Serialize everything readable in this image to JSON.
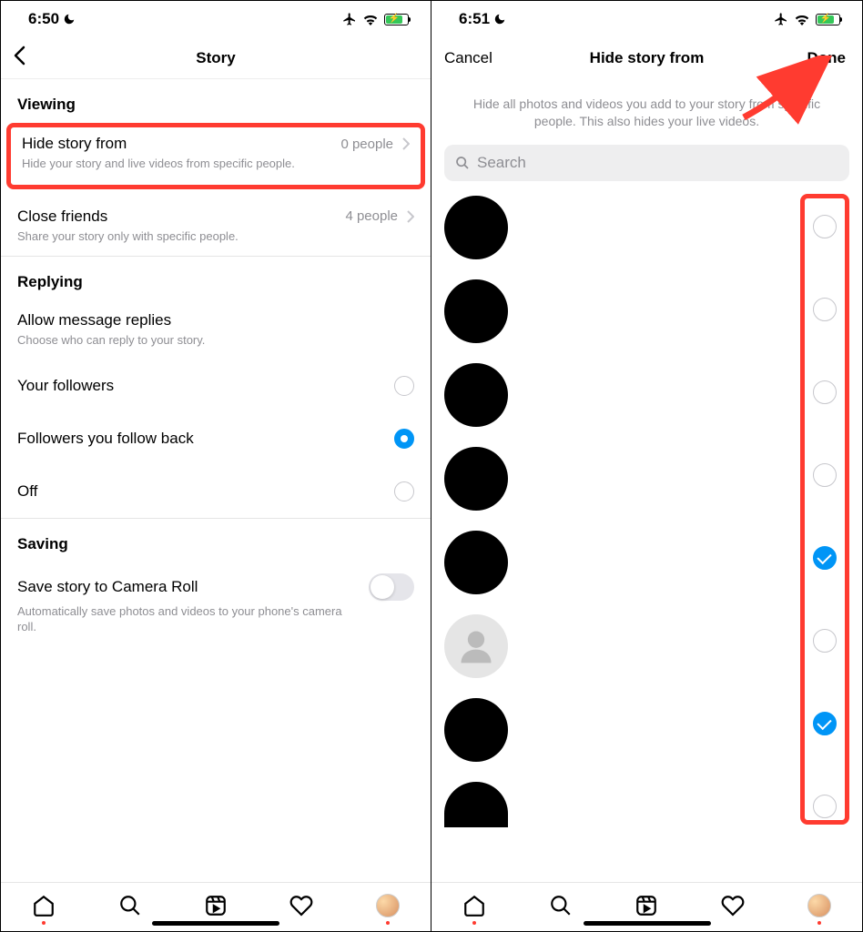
{
  "left": {
    "status_time": "6:50",
    "header_title": "Story",
    "sections": {
      "viewing": {
        "title": "Viewing",
        "hide_story": {
          "title": "Hide story from",
          "count": "0 people",
          "subtitle": "Hide your story and live videos from specific people."
        },
        "close_friends": {
          "title": "Close friends",
          "count": "4 people",
          "subtitle": "Share your story only with specific people."
        }
      },
      "replying": {
        "title": "Replying",
        "allow": {
          "title": "Allow message replies",
          "subtitle": "Choose who can reply to your story."
        },
        "options": {
          "followers": "Your followers",
          "follow_back": "Followers you follow back",
          "off": "Off"
        }
      },
      "saving": {
        "title": "Saving",
        "camera_roll": {
          "title": "Save story to Camera Roll",
          "subtitle": "Automatically save photos and videos to your phone's camera roll."
        }
      }
    }
  },
  "right": {
    "status_time": "6:51",
    "nav_cancel": "Cancel",
    "nav_title": "Hide story from",
    "nav_done": "Done",
    "info": "Hide all photos and videos you add to your story from specific people. This also hides your live videos.",
    "search_placeholder": "Search",
    "people": [
      {
        "type": "black",
        "checked": false
      },
      {
        "type": "black",
        "checked": false
      },
      {
        "type": "black",
        "checked": false
      },
      {
        "type": "black",
        "checked": false
      },
      {
        "type": "black",
        "checked": true
      },
      {
        "type": "placeholder",
        "checked": false
      },
      {
        "type": "black",
        "checked": true
      },
      {
        "type": "partial",
        "checked": false
      }
    ]
  }
}
